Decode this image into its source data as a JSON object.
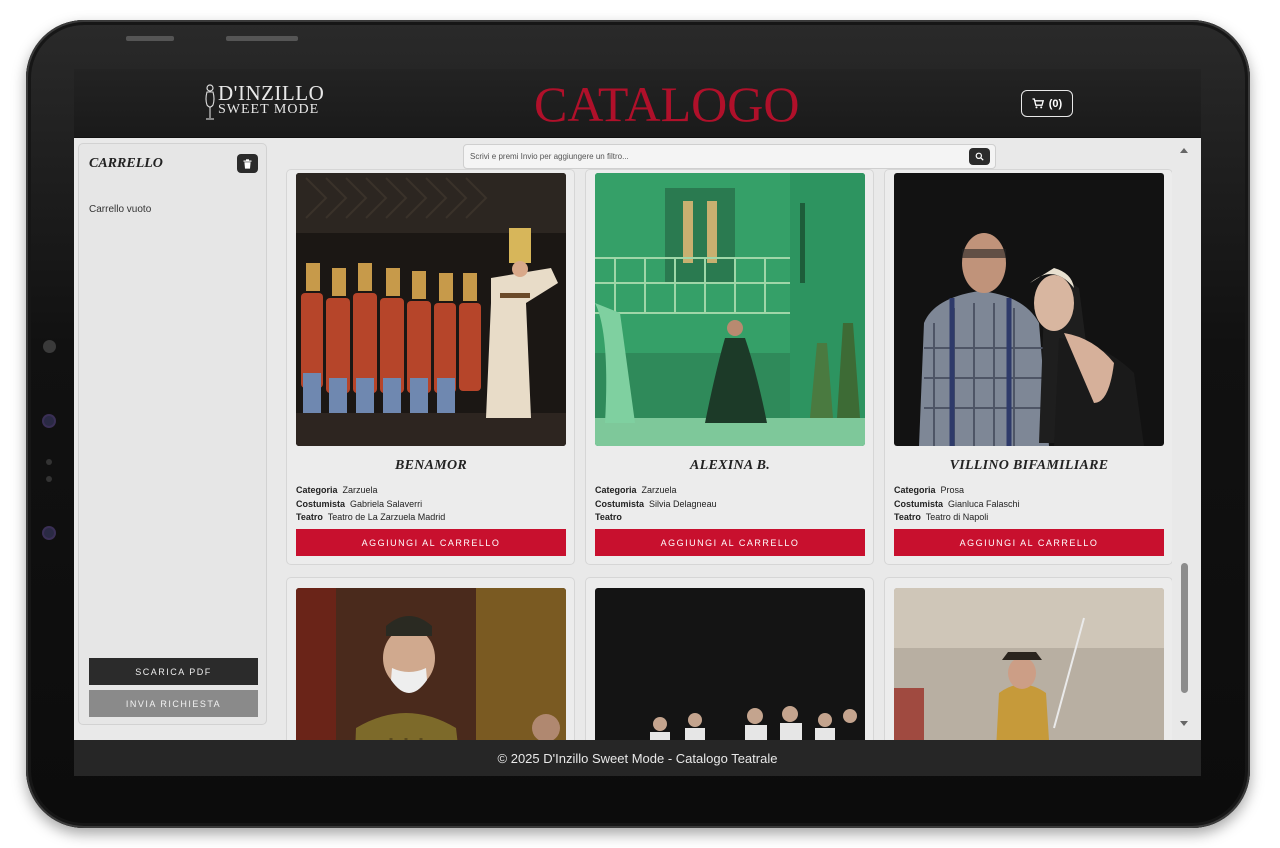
{
  "header": {
    "logo_line1": "D'INZILLO",
    "logo_line2": "SWEET MODE",
    "title": "CATALOGO",
    "cart_count": "(0)"
  },
  "sidebar": {
    "title": "CARRELLO",
    "empty_text": "Carrello vuoto",
    "pdf_label": "SCARICA PDF",
    "send_label": "INVIA RICHIESTA"
  },
  "search": {
    "placeholder": "Scrivi e premi Invio per aggiungere un filtro..."
  },
  "labels": {
    "categoria": "Categoria",
    "costumista": "Costumista",
    "teatro": "Teatro",
    "add_to_cart": "AGGIUNGI AL CARRELLO"
  },
  "cards": [
    {
      "name": "BENAMOR",
      "categoria": "Zarzuela",
      "costumista": "Gabriela Salaverri",
      "teatro": "Teatro de La Zarzuela Madrid"
    },
    {
      "name": "ALEXINA B.",
      "categoria": "Zarzuela",
      "costumista": "Silvia Delagneau",
      "teatro": ""
    },
    {
      "name": "VILLINO BIFAMILIARE",
      "categoria": "Prosa",
      "costumista": "Gianluca Falaschi",
      "teatro": "Teatro di Napoli"
    }
  ],
  "footer": {
    "text": "© 2025 D'Inzillo Sweet Mode - Catalogo Teatrale"
  },
  "colors": {
    "accent": "#c8102e",
    "title": "#b0102a",
    "header": "#1f1f1f",
    "dark_button": "#2b2b2b"
  }
}
